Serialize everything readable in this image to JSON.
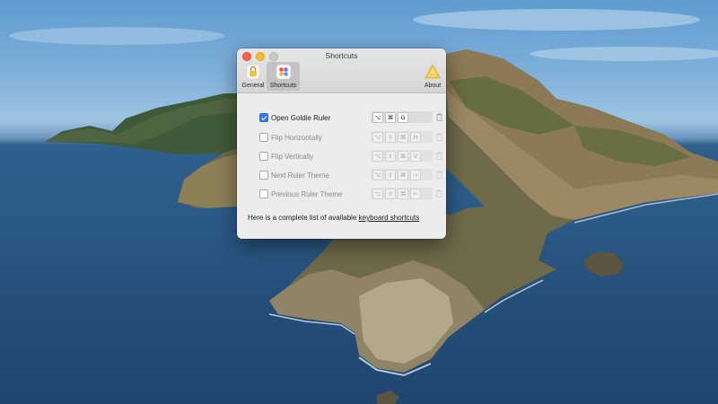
{
  "window": {
    "title": "Shortcuts",
    "tabs": [
      {
        "label": "General",
        "icon": "lock-icon"
      },
      {
        "label": "Shortcuts",
        "icon": "color-dots-icon",
        "selected": true
      },
      {
        "label": "About",
        "icon": "app-logo-icon"
      }
    ]
  },
  "shortcuts": [
    {
      "label": "Open Goldie Ruler",
      "checked": true,
      "keys": [
        "⌥",
        "⌘",
        "G"
      ]
    },
    {
      "label": "Flip Horizontally",
      "checked": false,
      "keys": [
        "⌥",
        "⇧",
        "⌘",
        "H"
      ]
    },
    {
      "label": "Flip Vertically",
      "checked": false,
      "keys": [
        "⌥",
        "⇧",
        "⌘",
        "V"
      ]
    },
    {
      "label": "Next Ruler Theme",
      "checked": false,
      "keys": [
        "⌥",
        "⇧",
        "⌘",
        "→"
      ]
    },
    {
      "label": "Previous Ruler Theme",
      "checked": false,
      "keys": [
        "⌥",
        "⇧",
        "⌘",
        "←"
      ]
    }
  ],
  "footer": {
    "text": "Here is a complete list of available ",
    "link": "keyboard shortcuts"
  },
  "colors": {
    "accent": "#3478f6",
    "close": "#fe5f57",
    "minimize": "#febc2e",
    "logo": "#f6c83c"
  }
}
